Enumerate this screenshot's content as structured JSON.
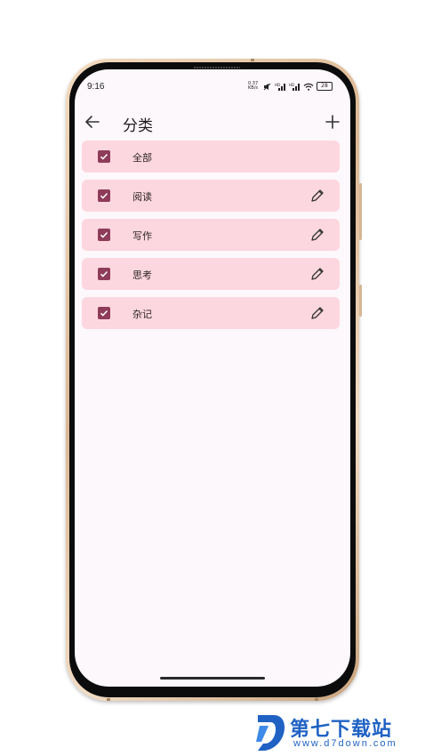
{
  "status_bar": {
    "time": "9:16",
    "net_speed": "0.37 KB/s",
    "battery": "28"
  },
  "app_bar": {
    "title": "分类"
  },
  "categories": [
    {
      "label": "全部",
      "checked": true,
      "editable": false
    },
    {
      "label": "阅读",
      "checked": true,
      "editable": true
    },
    {
      "label": "写作",
      "checked": true,
      "editable": true
    },
    {
      "label": "思考",
      "checked": true,
      "editable": true
    },
    {
      "label": "杂记",
      "checked": true,
      "editable": true
    }
  ],
  "colors": {
    "row_background": "#fdd7df",
    "checkbox": "#8e3c59",
    "screen_background": "#fdf8fc"
  },
  "watermark": {
    "title": "第七下载站",
    "url": "www.d7down.com"
  }
}
